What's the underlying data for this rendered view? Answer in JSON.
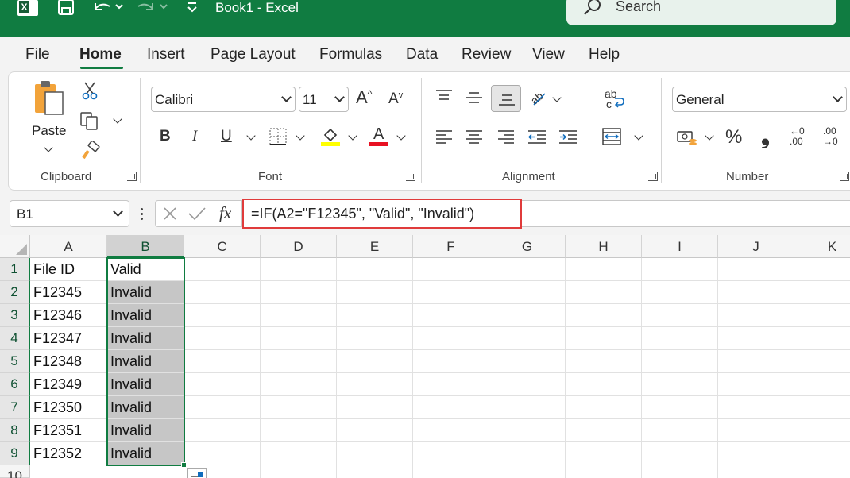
{
  "window": {
    "title": "Book1  -  Excel"
  },
  "search": {
    "placeholder": "Search"
  },
  "menu": {
    "items": [
      "File",
      "Home",
      "Insert",
      "Page Layout",
      "Formulas",
      "Data",
      "Review",
      "View",
      "Help"
    ],
    "active": "Home"
  },
  "ribbon": {
    "clipboard": {
      "label": "Clipboard",
      "paste_label": "Paste"
    },
    "font": {
      "label": "Font",
      "font_name": "Calibri",
      "font_size": "11",
      "bold": "B",
      "italic": "I",
      "underline": "U",
      "font_color": "#e81123",
      "highlight_color": "#ffff00"
    },
    "alignment": {
      "label": "Alignment"
    },
    "number": {
      "label": "Number",
      "format": "General",
      "percent": "%",
      "comma": "❟",
      "inc_decimal_top": "←0",
      "inc_decimal_bottom": ".00",
      "dec_decimal_top": ".00",
      "dec_decimal_bottom": "→0"
    }
  },
  "formula_bar": {
    "name_box": "B1",
    "fx_label": "fx",
    "formula": "=IF(A2=\"F12345\", \"Valid\", \"Invalid\")"
  },
  "grid": {
    "columns": [
      "A",
      "B",
      "C",
      "D",
      "E",
      "F",
      "G",
      "H",
      "I",
      "J",
      "K"
    ],
    "selected_column": "B",
    "rows": [
      "1",
      "2",
      "3",
      "4",
      "5",
      "6",
      "7",
      "8",
      "9",
      "10"
    ],
    "cells": {
      "A": [
        "File ID",
        "F12345",
        "F12346",
        "F12347",
        "F12348",
        "F12349",
        "F12350",
        "F12351",
        "F12352"
      ],
      "B": [
        "Valid",
        "Invalid",
        "Invalid",
        "Invalid",
        "Invalid",
        "Invalid",
        "Invalid",
        "Invalid",
        "Invalid"
      ]
    }
  },
  "colors": {
    "accent": "#107c41",
    "formula_highlight": "#e03b3b"
  }
}
